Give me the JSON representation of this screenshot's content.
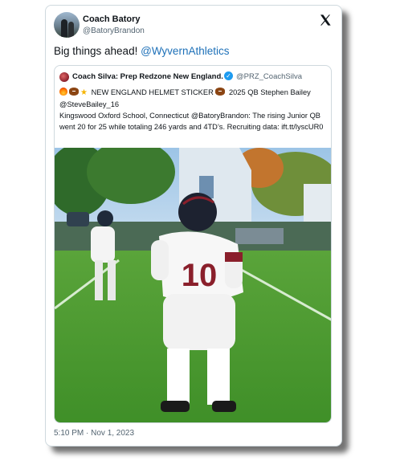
{
  "author": {
    "name": "Coach Batory",
    "handle": "@BatoryBrandon"
  },
  "tweet": {
    "text": "Big things ahead!",
    "mention": "@WyvernAthletics",
    "timestamp": "5:10 PM · Nov 1, 2023"
  },
  "quoted": {
    "name": "Coach Silva: Prep Redzone New England.",
    "handle": "@PRZ_CoachSilva",
    "line1": "NEW ENGLAND HELMET STICKER",
    "line1b": "2025 QB Stephen Bailey",
    "line2": "@SteveBailey_16",
    "line3": " Kingswood Oxford School, Connecticut @BatoryBrandon: The rising Junior QB went 20 for 25 while totaling 246 yards and 4TD’s. Recruiting data: ift.tt/lyscUR0",
    "jersey_number": "10"
  },
  "icons": {
    "platform": "x-logo-icon",
    "verified": "verified-badge-icon",
    "emoji": [
      "fire-emoji",
      "football-emoji",
      "star-emoji",
      "football-emoji"
    ]
  },
  "colors": {
    "mention": "#1d70b8",
    "secondary_text": "#536471",
    "verified": "#1d9bf0",
    "jersey_trim": "#8a1f2b"
  }
}
